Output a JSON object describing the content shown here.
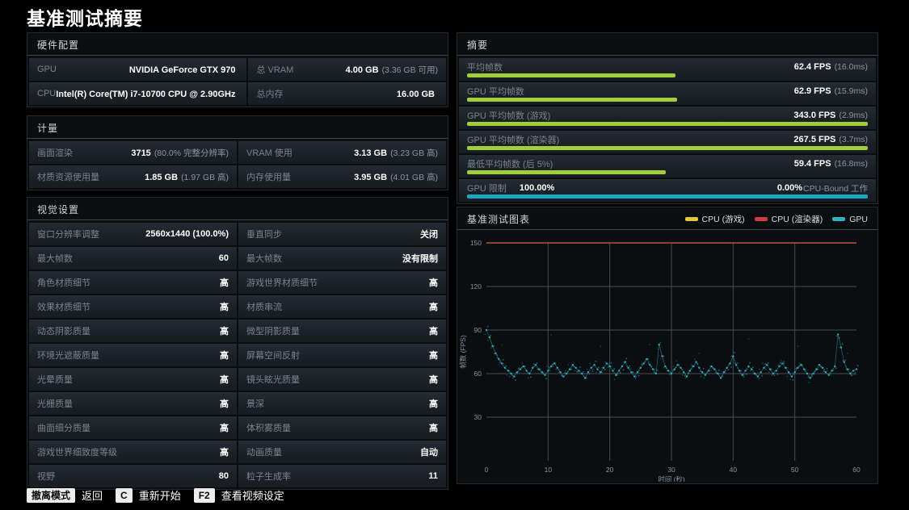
{
  "page_title": "基准测试摘要",
  "colors": {
    "accent_green": "#a2ce39",
    "accent_cyan": "#1fa9bd",
    "accent_red": "#cf3a46",
    "accent_yellow": "#e6c63e"
  },
  "hardware": {
    "title": "硬件配置",
    "cells": [
      {
        "label": "GPU",
        "value": "NVIDIA GeForce GTX 970",
        "note": ""
      },
      {
        "label": "总 VRAM",
        "value": "4.00 GB",
        "note": "(3.36 GB 可用)"
      },
      {
        "label": "CPU",
        "value": "Intel(R) Core(TM) i7-10700 CPU @ 2.90GHz",
        "note": ""
      },
      {
        "label": "总内存",
        "value": "16.00 GB",
        "note": ""
      }
    ]
  },
  "metrics": {
    "title": "计量",
    "cells": [
      {
        "label": "画面渲染",
        "value": "3715",
        "note": "(80.0% 完整分辨率)"
      },
      {
        "label": "VRAM 使用",
        "value": "3.13 GB",
        "note": "(3.23 GB 高)"
      },
      {
        "label": "材质资源使用量",
        "value": "1.85 GB",
        "note": "(1.97 GB 高)"
      },
      {
        "label": "内存使用量",
        "value": "3.95 GB",
        "note": "(4.01 GB 高)"
      }
    ]
  },
  "visual": {
    "title": "视觉设置",
    "cells": [
      {
        "label": "窗口分辨率调整",
        "value": "2560x1440 (100.0%)"
      },
      {
        "label": "垂直同步",
        "value": "关闭"
      },
      {
        "label": "最大帧数",
        "value": "60"
      },
      {
        "label": "最大帧数",
        "value": "没有限制"
      },
      {
        "label": "角色材质细节",
        "value": "高"
      },
      {
        "label": "游戏世界材质细节",
        "value": "高"
      },
      {
        "label": "效果材质细节",
        "value": "高"
      },
      {
        "label": "材质串流",
        "value": "高"
      },
      {
        "label": "动态阴影质量",
        "value": "高"
      },
      {
        "label": "微型阴影质量",
        "value": "高"
      },
      {
        "label": "环境光遮蔽质量",
        "value": "高"
      },
      {
        "label": "屏幕空间反射",
        "value": "高"
      },
      {
        "label": "光晕质量",
        "value": "高"
      },
      {
        "label": "镜头眩光质量",
        "value": "高"
      },
      {
        "label": "光栅质量",
        "value": "高"
      },
      {
        "label": "景深",
        "value": "高"
      },
      {
        "label": "曲面细分质量",
        "value": "高"
      },
      {
        "label": "体积雾质量",
        "value": "高"
      },
      {
        "label": "游戏世界细致度等级",
        "value": "高"
      },
      {
        "label": "动画质量",
        "value": "自动"
      },
      {
        "label": "视野",
        "value": "80"
      },
      {
        "label": "粒子生成率",
        "value": "11"
      }
    ]
  },
  "summary": {
    "title": "摘要",
    "rows": [
      {
        "label": "平均帧数",
        "label_extra": "",
        "value": "62.4 FPS",
        "note": "(16.0ms)",
        "bar_width": "52%",
        "bar_color": "#a2ce39"
      },
      {
        "label": "GPU 平均帧数",
        "label_extra": "",
        "value": "62.9 FPS",
        "note": "(15.9ms)",
        "bar_width": "52.4%",
        "bar_color": "#a2ce39"
      },
      {
        "label": "GPU 平均帧数 (游戏)",
        "label_extra": "",
        "value": "343.0 FPS",
        "note": "(2.9ms)",
        "bar_width": "100%",
        "bar_color": "#a2ce39"
      },
      {
        "label": "GPU 平均帧数 (渲染器)",
        "label_extra": "",
        "value": "267.5 FPS",
        "note": "(3.7ms)",
        "bar_width": "100%",
        "bar_color": "#a2ce39"
      },
      {
        "label": "最低平均帧数 (后 5%)",
        "label_extra": "",
        "value": "59.4 FPS",
        "note": "(16.8ms)",
        "bar_width": "49.5%",
        "bar_color": "#a2ce39"
      },
      {
        "label": "GPU 限制",
        "label_extra": "100.00%",
        "value": "0.00%",
        "note": "CPU-Bound 工作",
        "bar_width": "100%",
        "bar_color": "#1fa9bd"
      }
    ]
  },
  "chart_panel": {
    "title": "基准测试图表",
    "legend": [
      {
        "label": "CPU (游戏)",
        "color": "#e6c63e"
      },
      {
        "label": "CPU (渲染器)",
        "color": "#cf3a46"
      },
      {
        "label": "GPU",
        "color": "#2fb3c4"
      }
    ]
  },
  "chart_data": {
    "type": "line",
    "title": "基准测试图表",
    "xlabel": "时间 (秒)",
    "ylabel": "帧数 (FPS)",
    "xlim": [
      0,
      60
    ],
    "ylim": [
      0,
      150
    ],
    "xticks": [
      0,
      10,
      20,
      30,
      40,
      50,
      60
    ],
    "yticks": [
      30,
      60,
      90,
      120,
      150
    ],
    "grid": true,
    "legend_position": "top-right",
    "series": [
      {
        "name": "CPU (游戏)",
        "color": "#e6c63e",
        "avg_fps": 343.0,
        "display": "capped",
        "capped_at": 150
      },
      {
        "name": "CPU (渲染器)",
        "color": "#cf3a46",
        "avg_fps": 267.5,
        "display": "capped",
        "capped_at": 150
      },
      {
        "name": "GPU",
        "color": "#2fb3c4",
        "avg_fps": 62.9,
        "t_step": 0.5,
        "fps": [
          90,
          85,
          79,
          74,
          70,
          67,
          64,
          62,
          60,
          58,
          61,
          63,
          65,
          62,
          60,
          64,
          66,
          63,
          61,
          59,
          62,
          65,
          67,
          64,
          61,
          58,
          60,
          63,
          66,
          64,
          62,
          60,
          57,
          61,
          64,
          66,
          63,
          61,
          64,
          67,
          65,
          62,
          59,
          62,
          65,
          68,
          64,
          61,
          58,
          61,
          64,
          67,
          70,
          66,
          63,
          60,
          80,
          72,
          65,
          62,
          60,
          63,
          66,
          64,
          61,
          58,
          62,
          65,
          68,
          64,
          61,
          59,
          62,
          65,
          63,
          60,
          57,
          61,
          64,
          67,
          72,
          66,
          62,
          59,
          62,
          65,
          63,
          60,
          58,
          61,
          64,
          66,
          63,
          60,
          62,
          65,
          67,
          64,
          61,
          58,
          61,
          64,
          66,
          63,
          60,
          57,
          60,
          63,
          66,
          64,
          61,
          59,
          62,
          65,
          87,
          78,
          68,
          63,
          60,
          62,
          63
        ]
      }
    ]
  },
  "footer": {
    "items": [
      {
        "key": "撤离模式",
        "label": "返回"
      },
      {
        "key": "C",
        "label": "重新开始"
      },
      {
        "key": "F2",
        "label": "查看视频设定"
      }
    ]
  }
}
